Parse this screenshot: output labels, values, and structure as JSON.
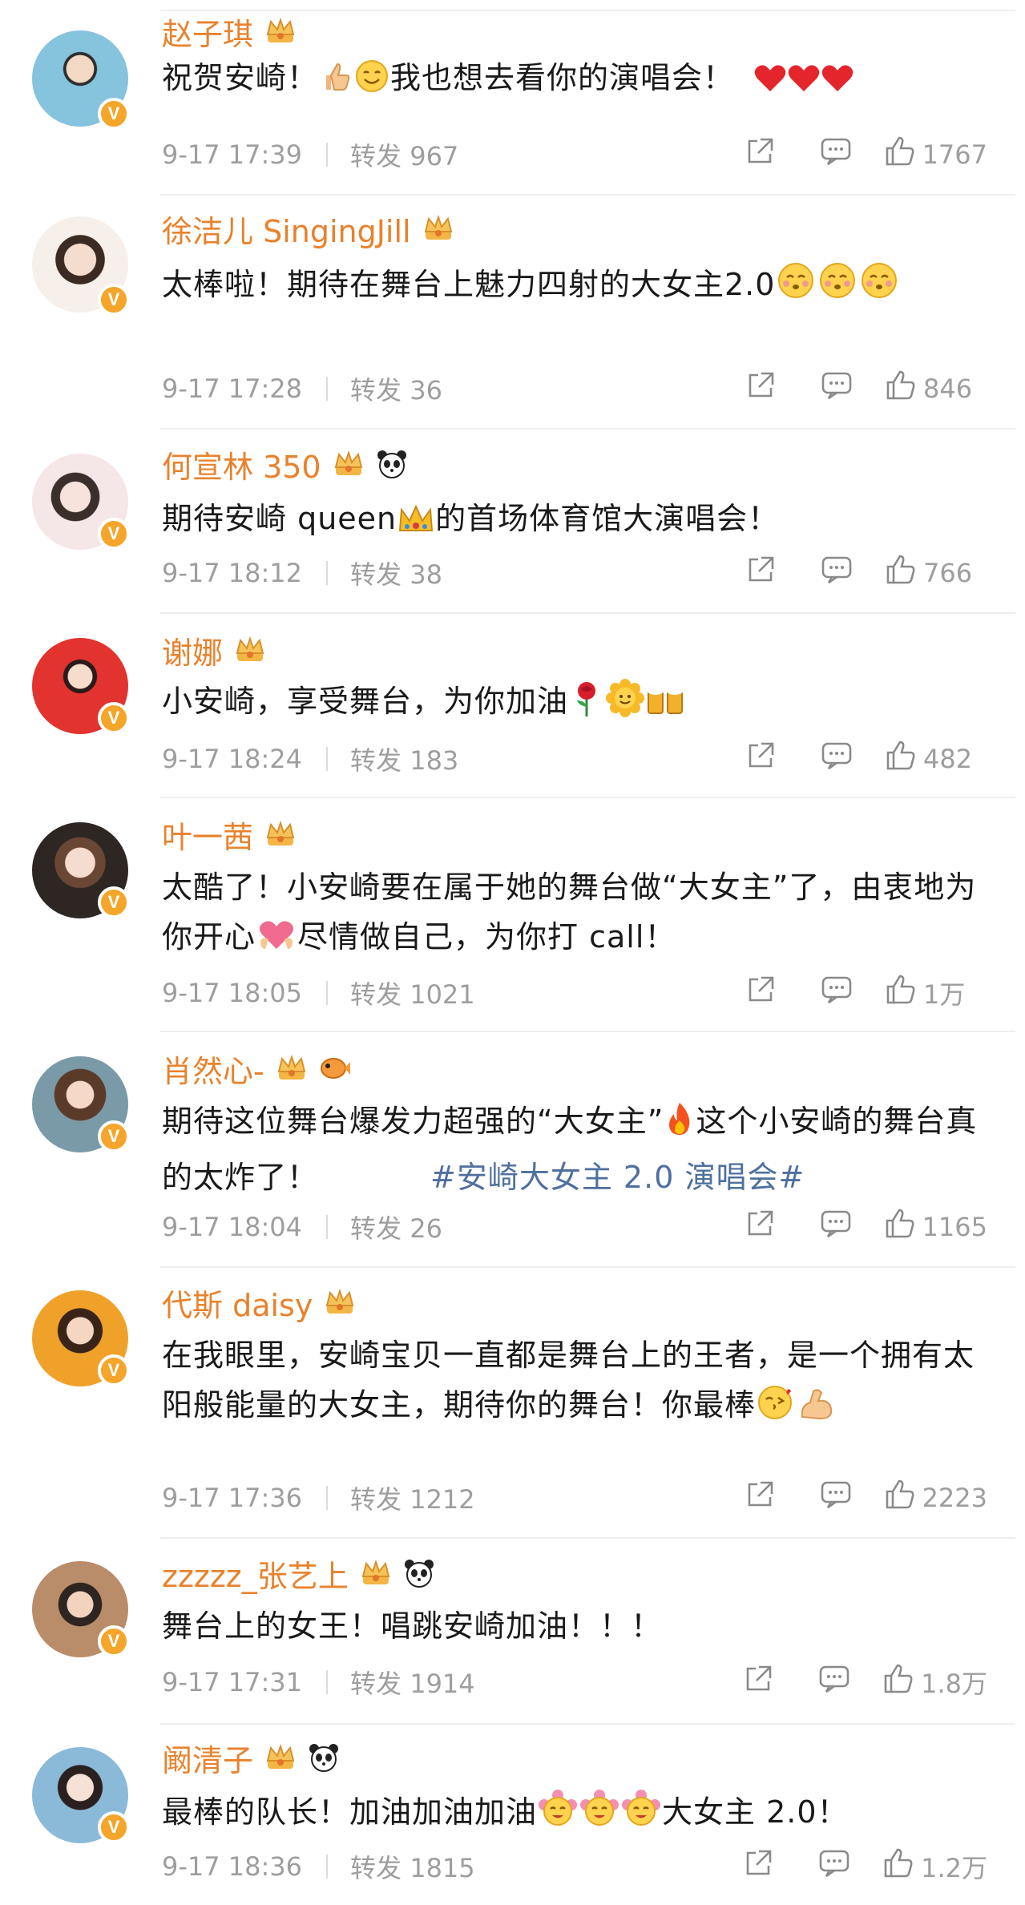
{
  "comments": [
    {
      "name": "赵子琪",
      "badges": [
        "crown-icon"
      ],
      "text": "祝贺安崎！",
      "emojis_after": [
        "thumbs-up-icon",
        "smile-icon"
      ],
      "text2": "我也想去看你的演唱会！",
      "trail": [
        "heart-icon",
        "heart-icon",
        "heart-icon"
      ],
      "time": "9-17 17:39",
      "repost_label": "转发",
      "repost_count": "967",
      "likes": "1767",
      "avatar_color": "#5aa7c9"
    },
    {
      "name": "徐洁儿 SingingJill",
      "badges": [
        "crown-icon"
      ],
      "text": "太棒啦！期待在舞台上魅力四射的大女主2.0",
      "trail": [
        "blush-icon",
        "blush-icon",
        "blush-icon"
      ],
      "time": "9-17 17:28",
      "repost_label": "转发",
      "repost_count": "36",
      "likes": "846",
      "avatar_color": "#e8d8d0"
    },
    {
      "name": "何宣林 350",
      "badges": [
        "crown-icon",
        "panda-icon"
      ],
      "text": "期待安崎 queen",
      "emojis_after": [
        "crown-emoji-icon"
      ],
      "text2": "的首场体育馆大演唱会！",
      "time": "9-17 18:12",
      "repost_label": "转发",
      "repost_count": "38",
      "likes": "766",
      "avatar_color": "#f2d7dc"
    },
    {
      "name": "谢娜",
      "badges": [
        "crown-icon"
      ],
      "text": "小安崎，享受舞台，为你加油",
      "trail": [
        "rose-icon",
        "sunflower-icon",
        "beer-icon"
      ],
      "time": "9-17 18:24",
      "repost_label": "转发",
      "repost_count": "183",
      "likes": "482",
      "avatar_color": "#d8242a"
    },
    {
      "name": "叶一茜",
      "badges": [
        "crown-icon"
      ],
      "text": "太酷了！小安崎要在属于她的舞台做“大女主”了，由衷地为你开心",
      "emojis_after": [
        "heart-hands-icon"
      ],
      "text2": "尽情做自己，为你打 call！",
      "time": "9-17 18:05",
      "repost_label": "转发",
      "repost_count": "1021",
      "likes": "1万",
      "avatar_color": "#c8a48c"
    },
    {
      "name": "肖然心-",
      "badges": [
        "crown-icon",
        "fish-icon"
      ],
      "text": "期待这位舞台爆发力超强的“大女主”",
      "emojis_after": [
        "fire-icon"
      ],
      "text2": "这个小安崎的舞台真的太炸了！",
      "hashtag": "#安崎大女主 2.0 演唱会#",
      "time": "9-17 18:04",
      "repost_label": "转发",
      "repost_count": "26",
      "likes": "1165",
      "avatar_color": "#4a6a80"
    },
    {
      "name": "代斯 daisy",
      "badges": [
        "crown-icon"
      ],
      "text": "在我眼里，安崎宝贝一直都是舞台上的王者，是一个拥有太阳般能量的大女主，期待你的舞台！你最棒",
      "trail": [
        "kiss-icon",
        "muscle-icon"
      ],
      "time": "9-17 17:36",
      "repost_label": "转发",
      "repost_count": "1212",
      "likes": "2223",
      "avatar_color": "#e0a12a"
    },
    {
      "name": "zzzzz_张艺上",
      "badges": [
        "crown-icon",
        "panda-icon"
      ],
      "text": "舞台上的女王！唱跳安崎加油！！！",
      "time": "9-17 17:31",
      "repost_label": "转发",
      "repost_count": "1914",
      "likes": "1.8万",
      "avatar_color": "#b98c6a"
    },
    {
      "name": "阚清子",
      "badges": [
        "crown-icon",
        "panda-icon"
      ],
      "text": "最棒的队长！加油加油加油",
      "emojis_after": [
        "flower-face-icon",
        "flower-face-icon",
        "flower-face-icon"
      ],
      "text2": "大女主 2.0！",
      "time": "9-17 18:36",
      "repost_label": "转发",
      "repost_count": "1815",
      "likes": "1.2万",
      "avatar_color": "#6fa7cf"
    }
  ],
  "verified_badge": "V"
}
